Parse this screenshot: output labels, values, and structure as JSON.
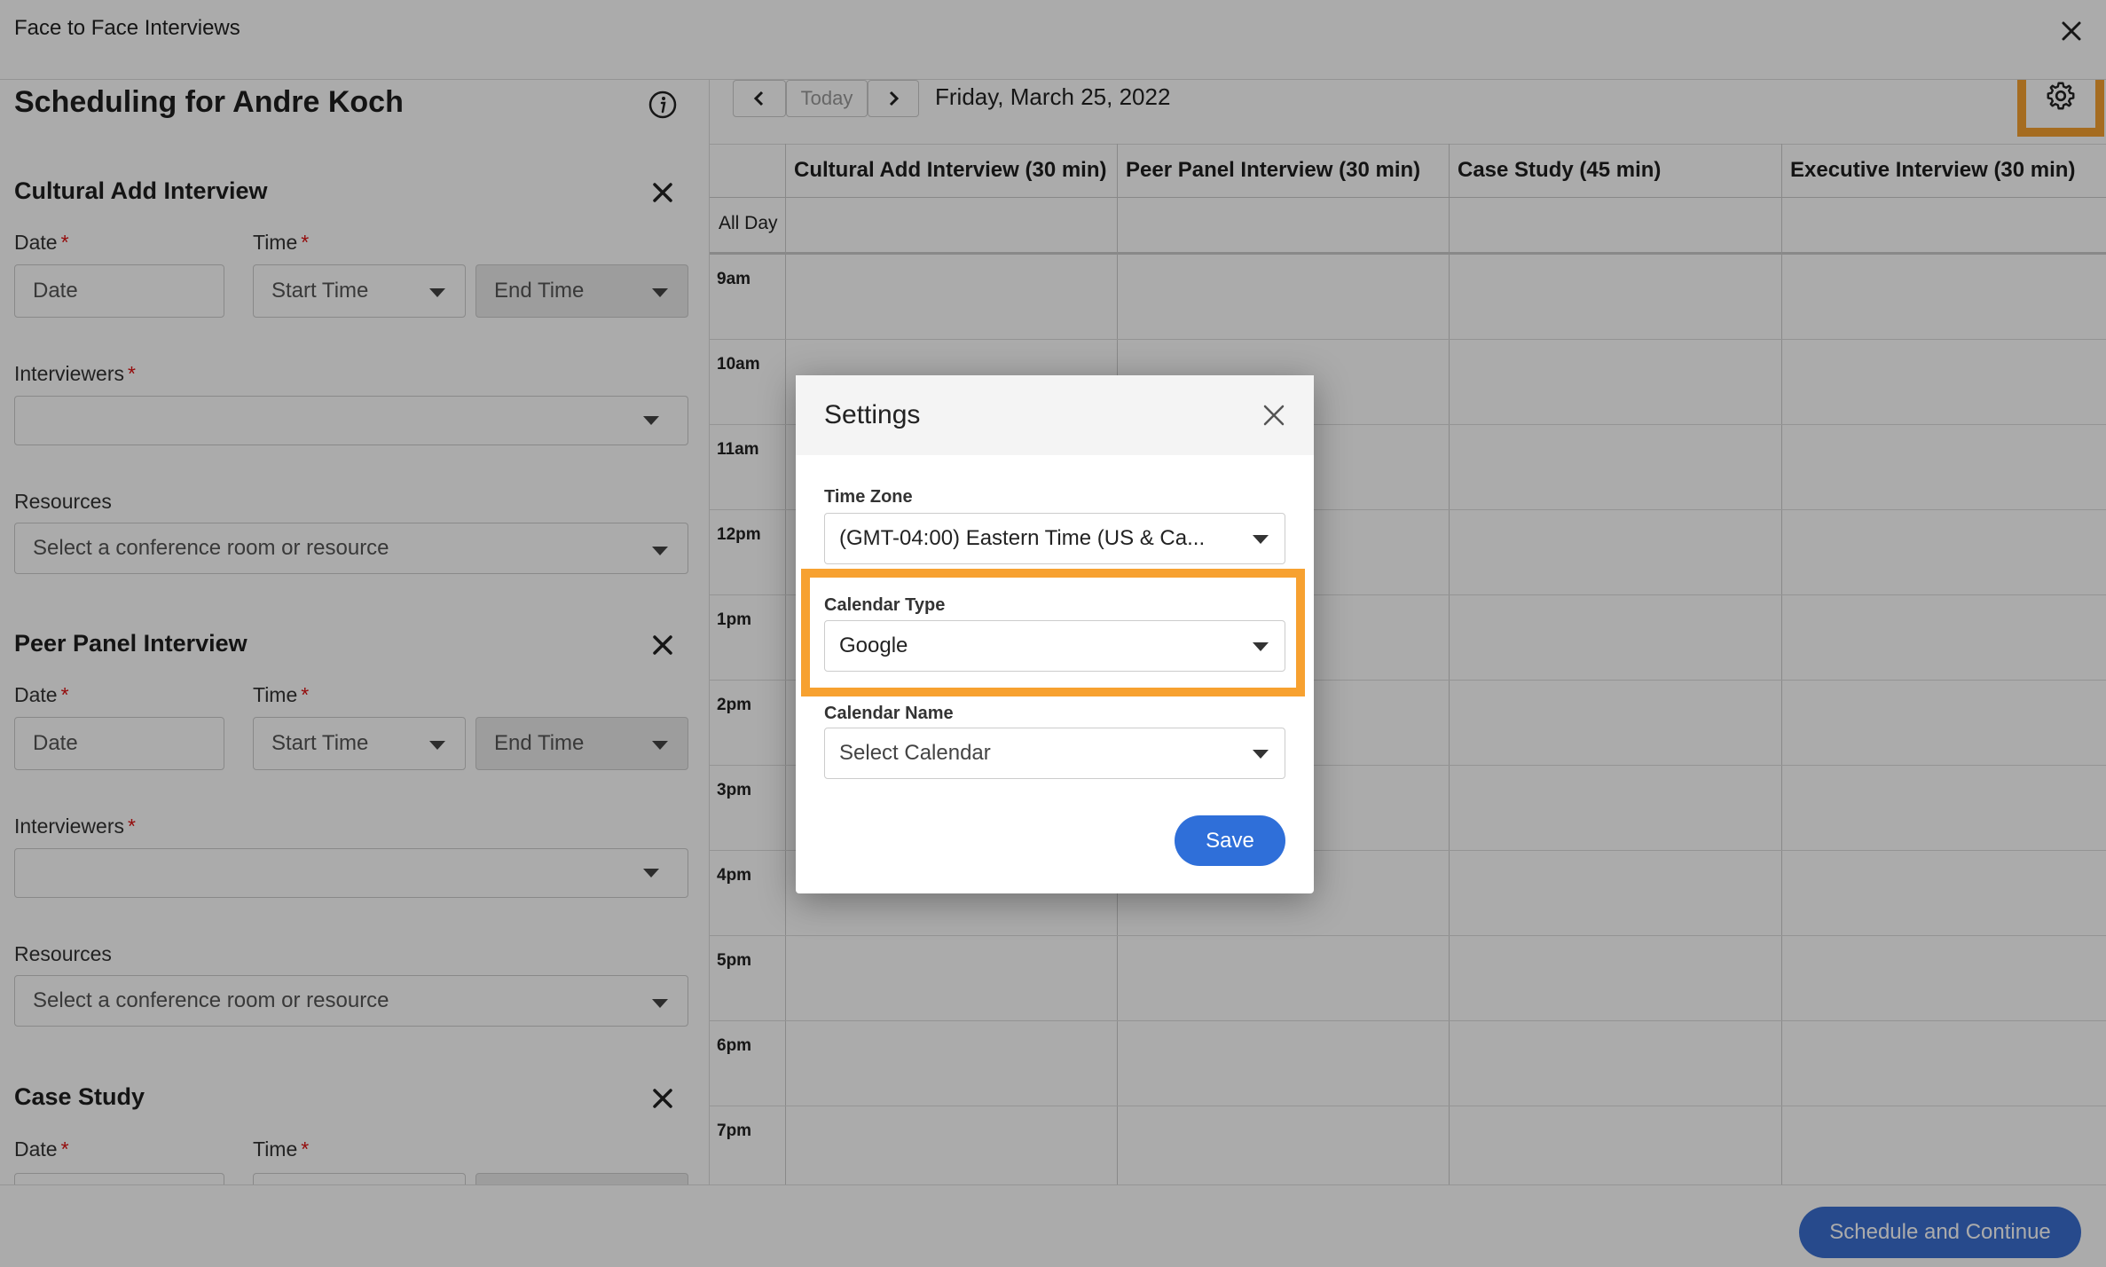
{
  "header": {
    "title": "Face to Face Interviews"
  },
  "left_panel": {
    "title": "Scheduling for Andre Koch",
    "sections": [
      {
        "title": "Cultural Add Interview",
        "date_label": "Date",
        "time_label": "Time",
        "date_placeholder": "Date",
        "start_placeholder": "Start Time",
        "end_placeholder": "End Time",
        "interviewers_label": "Interviewers",
        "resources_label": "Resources",
        "resources_placeholder": "Select a conference room or resource"
      },
      {
        "title": "Peer Panel Interview",
        "date_label": "Date",
        "time_label": "Time",
        "date_placeholder": "Date",
        "start_placeholder": "Start Time",
        "end_placeholder": "End Time",
        "interviewers_label": "Interviewers",
        "resources_label": "Resources",
        "resources_placeholder": "Select a conference room or resource"
      },
      {
        "title": "Case Study",
        "date_label": "Date",
        "time_label": "Time"
      }
    ],
    "required_mark": "*"
  },
  "calendar": {
    "today_label": "Today",
    "date": "Friday, March 25, 2022",
    "columns": [
      "Cultural Add Interview (30 min)",
      "Peer Panel Interview (30 min)",
      "Case Study (45 min)",
      "Executive Interview (30 min)"
    ],
    "all_day_label": "All Day",
    "hours": [
      "9am",
      "10am",
      "11am",
      "12pm",
      "1pm",
      "2pm",
      "3pm",
      "4pm",
      "5pm",
      "6pm",
      "7pm"
    ]
  },
  "footer": {
    "primary_button": "Schedule and Continue"
  },
  "modal": {
    "title": "Settings",
    "time_zone_label": "Time Zone",
    "time_zone_value": "(GMT-04:00) Eastern Time (US & Ca...",
    "calendar_type_label": "Calendar Type",
    "calendar_type_value": "Google",
    "calendar_name_label": "Calendar Name",
    "calendar_name_placeholder": "Select Calendar",
    "save_label": "Save"
  },
  "colors": {
    "accent": "#3b6fd1",
    "highlight": "#f7a130",
    "required": "#dd1111"
  },
  "icons": [
    "close-icon",
    "info-icon",
    "chevron-left-icon",
    "chevron-right-icon",
    "gear-icon",
    "chevron-down-icon"
  ]
}
